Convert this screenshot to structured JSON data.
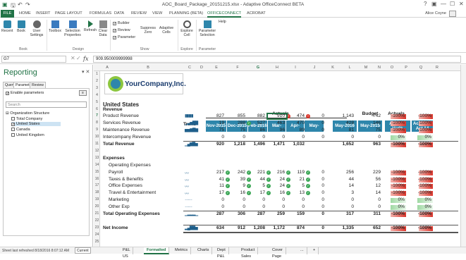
{
  "window": {
    "title": "AOC_Board_Package_20151215.xlsx - Adaptive OfficeConnect BETA",
    "user": "Alice Coyne",
    "controls": [
      "?",
      "▣",
      "—",
      "☐",
      "✕"
    ]
  },
  "ribbon_tabs": [
    "FILE",
    "HOME",
    "INSERT",
    "PAGE LAYOUT",
    "FORMULAS",
    "DATA",
    "REVIEW",
    "VIEW",
    "PLANNING (BETA)",
    "OFFICECONNECT",
    "ACROBAT"
  ],
  "ribbon": {
    "buttons": [
      "Recent",
      "Book",
      "User Settings",
      "Toolbox",
      "Selection Properties",
      "Refresh",
      "Clear Data",
      "Suppress Zero",
      "Adaptive Cells",
      "Explore Cell",
      "Parameter Selection"
    ],
    "checks": [
      "Builder",
      "Review",
      "Parameter"
    ],
    "help": "Help",
    "groups": [
      "Book",
      "Design",
      "Show",
      "Explore",
      "Parameter"
    ]
  },
  "formula_bar": {
    "cell": "G7",
    "fx": "fx",
    "value": "909.950009999998"
  },
  "pane": {
    "title": "Reporting",
    "tabs": [
      "Query",
      "Parameter",
      "Review"
    ],
    "enable": "Enable parameters",
    "search_placeholder": "Search",
    "root": "Organization Structure",
    "items": [
      {
        "label": "Total Company",
        "checked": false
      },
      {
        "label": "United States",
        "checked": true
      },
      {
        "label": "Canada",
        "checked": false
      },
      {
        "label": "United Kingdom",
        "checked": false
      }
    ]
  },
  "columns": [
    "A",
    "B",
    "C",
    "D",
    "E",
    "F",
    "G",
    "H",
    "I",
    "J",
    "K",
    "L",
    "M",
    "N",
    "O",
    "P",
    "Q",
    "R"
  ],
  "rows": [
    "1",
    "2",
    "3",
    "4",
    "5",
    "6",
    "7",
    "8",
    "9",
    "10",
    "11",
    "12",
    "13",
    "14",
    "15",
    "16",
    "17",
    "18",
    "19",
    "20",
    "21",
    "22",
    "23",
    "24",
    "25"
  ],
  "sheet": {
    "logo": "YourCompany,Inc.",
    "region": "United States",
    "group_headers": {
      "actuals": "Actuals",
      "budget": "Budget",
      "actuals2": "Actuals"
    },
    "col_headers": [
      "Trend",
      "Nov-2015",
      "Dec-2015",
      "Feb-2016",
      "Mar-2016",
      "Apr-2016",
      "May-2016",
      "May-2016",
      "May-2015",
      "Act/Bud Var%",
      "Act 15 to Act 14"
    ],
    "lines": [
      {
        "label": "Revenue",
        "bold": true
      },
      {
        "label": "Product Revenue",
        "vals": [
          "827",
          "855",
          "882",
          "910",
          "474",
          "0",
          "1,143",
          "742",
          "-100%",
          "-100%"
        ],
        "trend": "▮▮▮▮▮",
        "dots": [
          0,
          0,
          0,
          2,
          2
        ]
      },
      {
        "label": "Services Revenue",
        "vals": [
          "19",
          "288",
          "527",
          "463",
          "470",
          "0",
          "428",
          "146",
          "-100%",
          "-100%"
        ],
        "trend": "▁▃▅▇▇",
        "dots": [
          0,
          1,
          0,
          0,
          0
        ]
      },
      {
        "label": "Maintenance Revenue",
        "vals": [
          "75",
          "75",
          "86",
          "96",
          "89",
          "0",
          "81",
          "75",
          "-100%",
          "-100%"
        ],
        "trend": "▅▅▆▇▆"
      },
      {
        "label": "Intercompany Revenue",
        "vals": [
          "0",
          "0",
          "0",
          "0",
          "0",
          "0",
          "0",
          "0",
          "0%",
          "0%"
        ],
        "trend": ""
      },
      {
        "label": "Total Revenue",
        "bold": true,
        "vals": [
          "920",
          "1,218",
          "1,496",
          "1,471",
          "1,032",
          "",
          "1,652",
          "963",
          "-100%",
          "-100%"
        ],
        "trend": "▁▄▆▇▅",
        "total": true
      },
      {
        "label": ""
      },
      {
        "label": "Expenses",
        "bold": true
      },
      {
        "label": "Operating Expenses",
        "indent": 1
      },
      {
        "label": "Payroll",
        "indent": 1,
        "vals": [
          "217",
          "242",
          "221",
          "216",
          "119",
          "0",
          "256",
          "229",
          "-100%",
          "-100%"
        ],
        "trend": "〰",
        "dots": [
          1,
          1,
          1,
          1,
          1
        ]
      },
      {
        "label": "Taxes & Benefits",
        "indent": 1,
        "vals": [
          "41",
          "39",
          "44",
          "24",
          "21",
          "0",
          "44",
          "56",
          "-100%",
          "-100%"
        ],
        "trend": "〰",
        "dots": [
          1,
          1,
          1,
          1,
          1
        ]
      },
      {
        "label": "Office Expenses",
        "indent": 1,
        "vals": [
          "11",
          "9",
          "5",
          "24",
          "5",
          "0",
          "14",
          "12",
          "-100%",
          "-100%"
        ],
        "trend": "〰",
        "dots": [
          1,
          1,
          1,
          1,
          1
        ]
      },
      {
        "label": "Travel & Entertainment",
        "indent": 1,
        "vals": [
          "17",
          "16",
          "17",
          "16",
          "13",
          "0",
          "3",
          "14",
          "-100%",
          "-100%"
        ],
        "trend": "〰",
        "dots": [
          1,
          1,
          1,
          1,
          1
        ]
      },
      {
        "label": "Marketing",
        "indent": 1,
        "vals": [
          "0",
          "0",
          "0",
          "0",
          "0",
          "0",
          "0",
          "0",
          "0%",
          "0%"
        ],
        "trend": "……"
      },
      {
        "label": "Other Exp",
        "indent": 1,
        "vals": [
          "0",
          "0",
          "0",
          "0",
          "0",
          "0",
          "0",
          "0",
          "0%",
          "0%"
        ],
        "trend": "……"
      },
      {
        "label": "Total Operating Expenses",
        "bold": true,
        "vals": [
          "287",
          "306",
          "287",
          "259",
          "159",
          "0",
          "317",
          "311",
          "-100%",
          "-100%"
        ],
        "trend": "▁▂▂▂▁",
        "total": true
      },
      {
        "label": ""
      },
      {
        "label": "Net Income",
        "bold": true,
        "vals": [
          "634",
          "912",
          "1,208",
          "1,172",
          "874",
          "0",
          "1,335",
          "652",
          "-100%",
          "-100%"
        ],
        "trend": "▂▄▇▇▅",
        "net": true
      }
    ]
  },
  "sheet_tabs": [
    "P&L US",
    "Formatted",
    "Metrics",
    "Charts",
    "Dept P&L",
    "Product Sales",
    "Cover Page",
    "...",
    "+"
  ],
  "active_sheet": "Formatted",
  "status": {
    "text": "Sheet last refreshed 8/18/2016 8:07:12 AM",
    "mode": "Current"
  }
}
